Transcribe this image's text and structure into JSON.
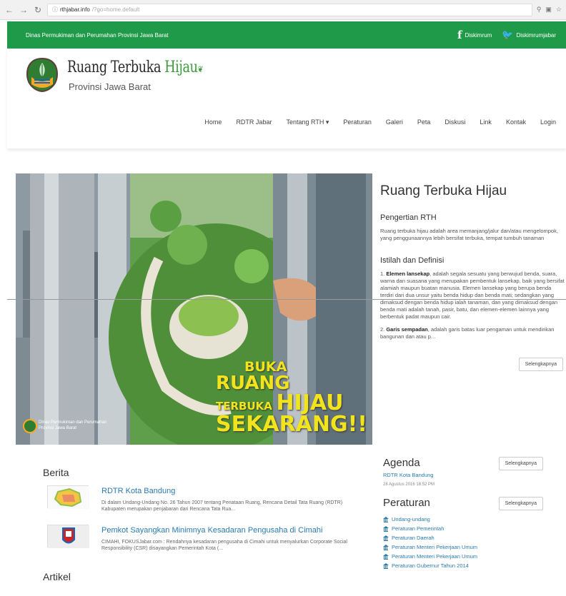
{
  "browser": {
    "url_host": "rthjabar.info",
    "url_path": "/?go=home.default"
  },
  "topbar": {
    "org": "Dinas Permukiman dan Perumahan Provinsi Jawa Barat",
    "facebook": "Diskimrum",
    "twitter": "Diskimrumjabar"
  },
  "brand": {
    "title_main": "Ruang Terbuka ",
    "title_accent": "Hijau",
    "subtitle": "Provinsi Jawa Barat"
  },
  "menu": [
    "Home",
    "RDTR Jabar",
    "Tentang RTH ▾",
    "Peraturan",
    "Galeri",
    "Peta",
    "Diskusi",
    "Link",
    "Kontak",
    "Login"
  ],
  "hero": {
    "line1": "BUKA",
    "line2": "RUANG",
    "line3": "TERBUKA",
    "line4": "HIJAU",
    "line5": "SEKARANG!!",
    "caption": "Dinas Permukiman dan Perumahan Provinsi Jawa Barat"
  },
  "side": {
    "title": "Ruang Terbuka Hijau",
    "section1_title": "Pengertian RTH",
    "section1_text": "Ruang terbuka hijau adalah area memanjang/jalur dan/atau mengelompok, yang penggunaannya lebih bersifat terbuka, tempat tumbuh tanaman",
    "section2_title": "Istilah dan Definisi",
    "def1_term": "Elemen lansekap",
    "def1_text": ", adalah segala sesuatu yang berwujud benda, suara, warna dan suasana yang merupakan pembentuk lansekap, baik yang bersifat alamiah maupun buatan manusia. Elemen lansekap yang berupa benda terdiri dari dua unsur yaitu benda hidup dan benda mati; sedangkan yang dimaksud dengan benda hidup ialah tanaman, dan yang dimaksud dengan benda mati adalah tanah, pasir, batu, dan elemen-elemen lainnya yang berbentuk padat maupun cair.",
    "def2_term": "Garis sempadan",
    "def2_text": ", adalah garis batas luar pengaman untuk mendirikan bangunan dan atau p...",
    "read_more": "Selengkapnya"
  },
  "berita": {
    "title": "Berita",
    "items": [
      {
        "title": "RDTR Kota Bandung",
        "body": "Di dalam Undang-Undang No. 26 Tahun 2007 tentang Penataan Ruang, Rencana Detail Tata Ruang (RDTR) Kabupaten merupakan penjabaran dari Rencana Tata Rua..."
      },
      {
        "title": "Pemkot Sayangkan Minimnya Kesadaran Pengusaha di Cimahi",
        "body": "CIMAHI, FOKUSJabar.com : Rendahnya kesadaran pengusaha di Cimahi untuk menyalurkan Corporate Social Responsibility (CSR) disayangkan Pemerintah Kota (..."
      }
    ]
  },
  "artikel": {
    "title": "Artikel"
  },
  "agenda": {
    "title": "Agenda",
    "read_more": "Selengkapnya",
    "item_title": "RDTR Kota Bandung",
    "item_date": "28 Agustus 2016 18:52 PM"
  },
  "peraturan": {
    "title": "Peraturan",
    "read_more": "Selengkapnya",
    "items": [
      "Undang-undang",
      "Peraturan Pemerintah",
      "Peraturan Daerah",
      "Peraturan Menteri Pekerjaan Umum",
      "Peraturan Menteri Pekerjaan Umum",
      "Peraturan Gubernur Tahun 2014"
    ]
  },
  "colors": {
    "topbar": "#1f9a48",
    "link": "#2a7ab0",
    "hero_yellow": "#f2e41c"
  }
}
